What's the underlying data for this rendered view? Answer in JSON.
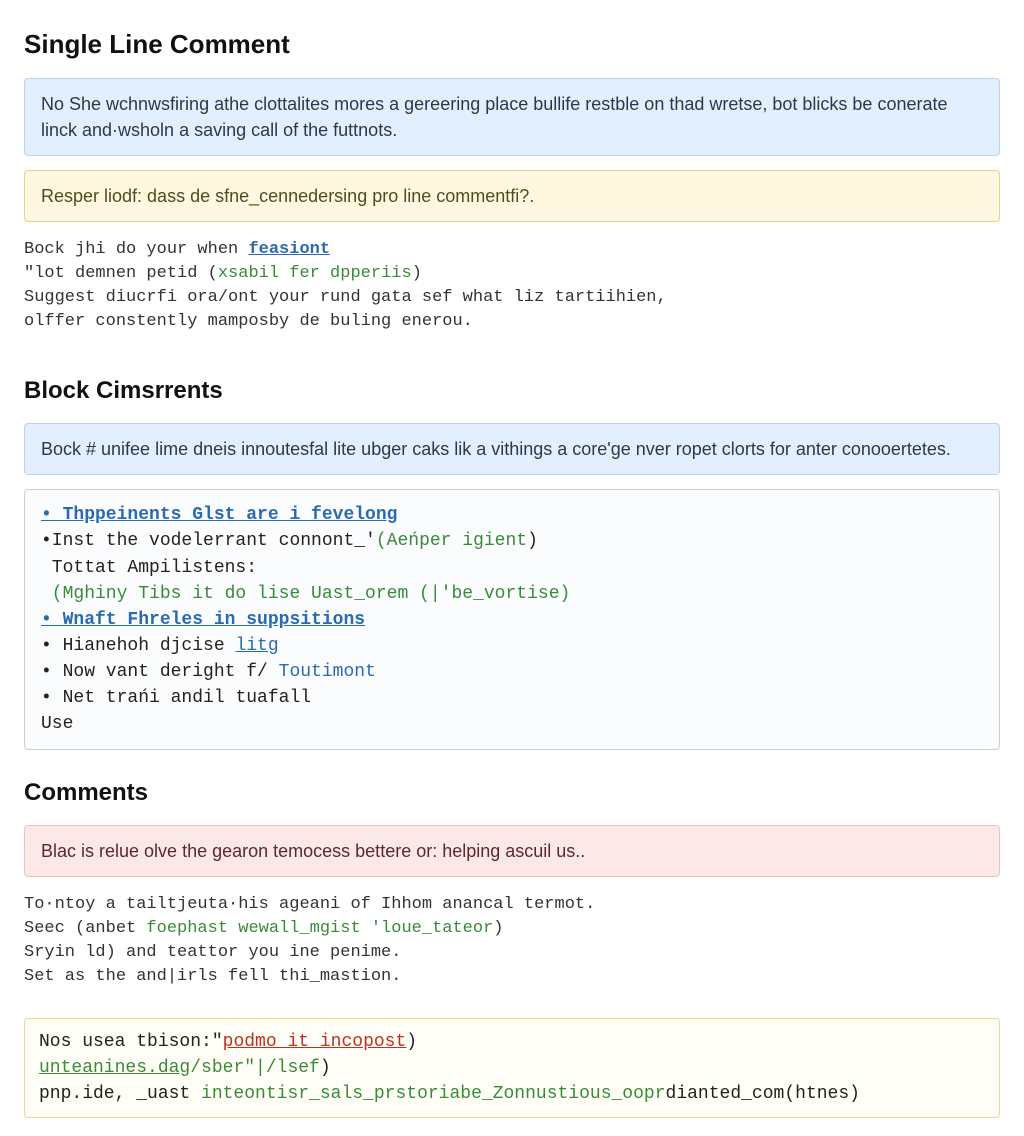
{
  "section1": {
    "heading": "Single Line Comment",
    "blue_box": "No She wchnwsfiring athe clottalites mores a gereering place bullife restble on thad wretse, bot blicks be conerate linck and·wsholn a saving call of the futtnots.",
    "yellow_box": "Resper liodf: dass de sfne_cennedersing pro line commentfi?.",
    "code": {
      "l1a": "Bock jhi do your when ",
      "l1b": "feasiont",
      "l2a": "\"lot demnen petid (",
      "l2b": "xsabil fer dpperiis",
      "l2c": ")",
      "l3": "Suggest diucrfi ora/ont your rund gata sef what liz tartiihien,",
      "l4": "olffer constently mamposby de buling enerou."
    }
  },
  "section2": {
    "heading": "Block Cimsrrents",
    "blue_box": "Bock # unifee lime dneis innoutesfal lite ubger caks lik a vithings a core'ge nver ropet clorts for anter conooertetes.",
    "code": {
      "l1": "• Thppeinents Glst are i fevelong",
      "l2a": "•Inst the vodelerrant connont_'",
      "l2b": "(Aeńper igient",
      "l2c": ")",
      "l3": " Tottat Ampilistens:",
      "l4a": " (Mghiny Tibs it do lise Uast_orem (",
      "l4b": "|'be_vortise",
      "l4c": ")",
      "l5": "• Wnaft Fhreles in suppsitions",
      "l6a": "• Hianehoh djcise ",
      "l6b": "litg",
      "l7a": "• Now vant deright f/ ",
      "l7b": "Toutimont",
      "l8a": "• Net trańi andil ",
      "l8b": "tuafall",
      "l9": "Use"
    }
  },
  "section3": {
    "heading": "Comments",
    "red_box": "Blac is relue olve the gearon temocess bettere or: helping ascuil us..",
    "code": {
      "l1": "To·ntoy a tailtjeuta·his ageani of Ihhom anancal termot.",
      "l2a": "Seec (anbet ",
      "l2b": "foephast wewall_mgist 'loue_tateor",
      "l2c": ")",
      "l3": "Sryin ld) and teattor you ine penime.",
      "l4a": "Set as the and|irls fel",
      "l4b": "l thi_mastion",
      "l4c": "."
    },
    "code2": {
      "l1a": "Nos usea tbison:\"",
      "l1b": "podmo it incopost",
      "l1c": ")",
      "l2a": "unteanines.dag",
      "l2b": "/sber\"|/lsef",
      "l2c": ")",
      "l3a": "pnp.ide, _uast ",
      "l3b": "inteontisr_sals_prstoriabe_Zonnustious_oopr",
      "l3c": "dianted_com(htnes)"
    }
  }
}
